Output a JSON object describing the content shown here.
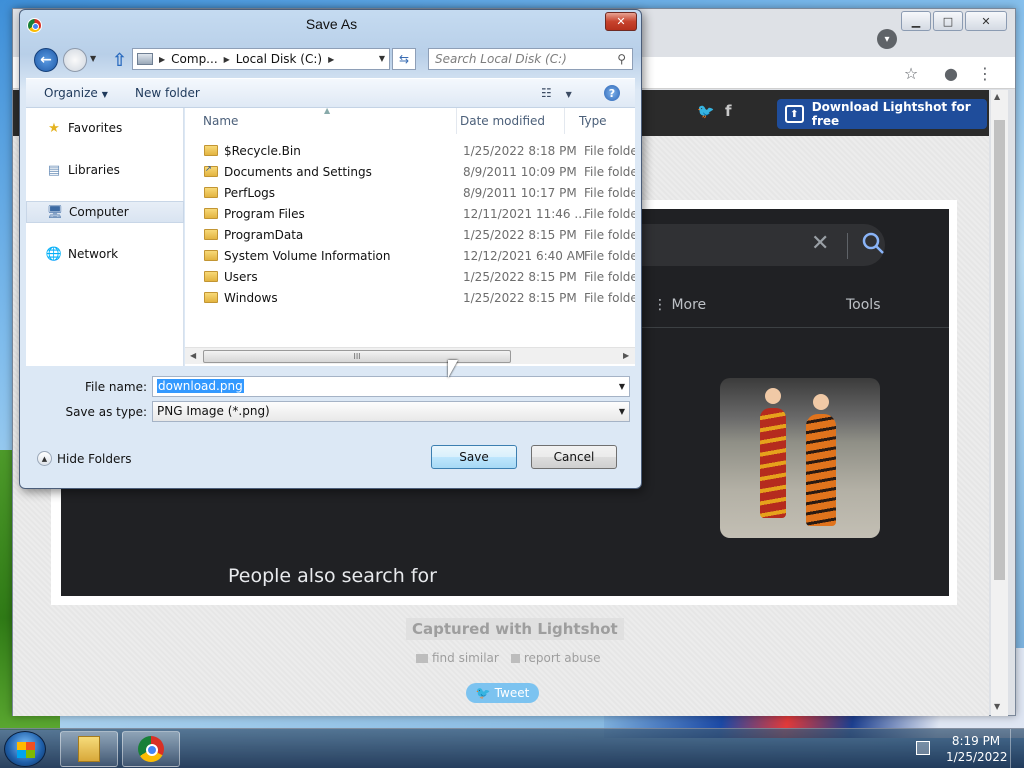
{
  "dialog": {
    "title": "Save As",
    "close_glyph": "✕",
    "nav": {
      "back_icon": "back-arrow-icon",
      "forward_icon": "forward-arrow-icon",
      "up_icon": "up-arrow-icon",
      "breadcrumb": [
        "Comp...",
        "Local Disk (C:)"
      ],
      "search_placeholder": "Search Local Disk (C:)"
    },
    "commands": {
      "organize": "Organize",
      "new_folder": "New folder"
    },
    "nav_pane": [
      {
        "label": "Favorites",
        "icon": "star-icon",
        "selected": false
      },
      {
        "label": "Libraries",
        "icon": "library-icon",
        "selected": false
      },
      {
        "label": "Computer",
        "icon": "computer-icon",
        "selected": true
      },
      {
        "label": "Network",
        "icon": "network-icon",
        "selected": false
      }
    ],
    "columns": {
      "name": "Name",
      "date": "Date modified",
      "type": "Type"
    },
    "files": [
      {
        "name": "$Recycle.Bin",
        "date": "1/25/2022 8:18 PM",
        "type": "File folder",
        "shortcut": false
      },
      {
        "name": "Documents and Settings",
        "date": "8/9/2011 10:09 PM",
        "type": "File folder",
        "shortcut": true
      },
      {
        "name": "PerfLogs",
        "date": "8/9/2011 10:17 PM",
        "type": "File folder",
        "shortcut": false
      },
      {
        "name": "Program Files",
        "date": "12/11/2021 11:46 ...",
        "type": "File folder",
        "shortcut": false
      },
      {
        "name": "ProgramData",
        "date": "1/25/2022 8:15 PM",
        "type": "File folder",
        "shortcut": false
      },
      {
        "name": "System Volume Information",
        "date": "12/12/2021 6:40 AM",
        "type": "File folder",
        "shortcut": false
      },
      {
        "name": "Users",
        "date": "1/25/2022 8:15 PM",
        "type": "File folder",
        "shortcut": false
      },
      {
        "name": "Windows",
        "date": "1/25/2022 8:15 PM",
        "type": "File folder",
        "shortcut": false
      }
    ],
    "file_name_label": "File name:",
    "file_name_value": "download.png",
    "save_type_label": "Save as type:",
    "save_type_value": "PNG Image (*.png)",
    "hide_folders": "Hide Folders",
    "save_button": "Save",
    "cancel_button": "Cancel",
    "hscroll_grip": "III"
  },
  "browser": {
    "lightshot": {
      "download_button": "Download Lightshot for free",
      "captured": "Captured with Lightshot",
      "find_similar": "find similar",
      "report_abuse": "report abuse",
      "tweet": "Tweet"
    },
    "screenshot": {
      "more": "More",
      "tools": "Tools",
      "people_also_search": "People also search for"
    }
  },
  "taskbar": {
    "time": "8:19 PM",
    "date": "1/25/2022"
  },
  "colors": {
    "lightshot_blue": "#1f4d9b",
    "dialog_frame": "#b8cfe8",
    "google_dark": "#202124"
  }
}
